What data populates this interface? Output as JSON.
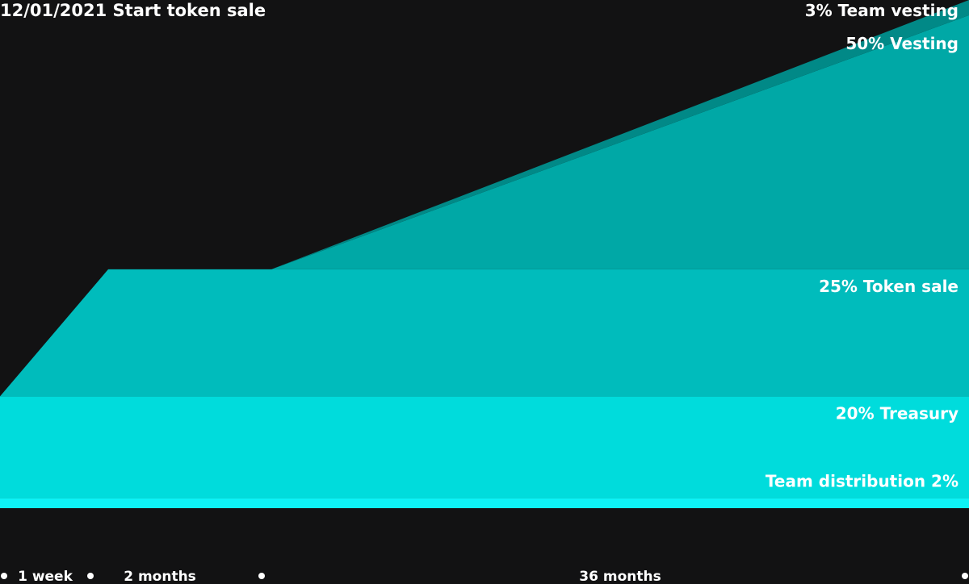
{
  "chart_data": {
    "type": "area",
    "title": "12/01/2021 Start token sale",
    "x_ticks": [
      {
        "label": "",
        "month": 0
      },
      {
        "label": "1 week",
        "month": 0.25
      },
      {
        "label": "",
        "month": 0.55
      },
      {
        "label": "2 months",
        "month": 2
      },
      {
        "label": "",
        "month": 3.4
      },
      {
        "label": "36 months",
        "month": 17.5
      },
      {
        "label": "",
        "month": 36
      }
    ],
    "x_range": [
      0,
      36
    ],
    "y_range_percent": [
      0,
      100
    ],
    "series": [
      {
        "name": "Team distribution 2%",
        "percent": 2,
        "color": "#0df3f6",
        "unlock": [
          [
            0,
            2
          ],
          [
            36,
            2
          ]
        ]
      },
      {
        "name": "20% Treasury",
        "percent": 20,
        "color": "#00dcdc",
        "unlock": [
          [
            0,
            20
          ],
          [
            36,
            20
          ]
        ]
      },
      {
        "name": "25% Token sale",
        "percent": 25,
        "color": "#00bcbc",
        "unlock": [
          [
            0,
            0
          ],
          [
            2,
            25
          ],
          [
            36,
            25
          ]
        ]
      },
      {
        "name": "50% Vesting",
        "percent": 50,
        "color": "#00a8a6",
        "unlock": [
          [
            0,
            0
          ],
          [
            2,
            0
          ],
          [
            5,
            0
          ],
          [
            36,
            50
          ]
        ]
      },
      {
        "name": "3% Team vesting",
        "percent": 3,
        "color": "#018987",
        "unlock": [
          [
            0,
            0
          ],
          [
            2,
            0
          ],
          [
            5,
            0
          ],
          [
            36,
            3
          ]
        ]
      }
    ],
    "legend": "labels at right end of each band",
    "grid": false
  }
}
